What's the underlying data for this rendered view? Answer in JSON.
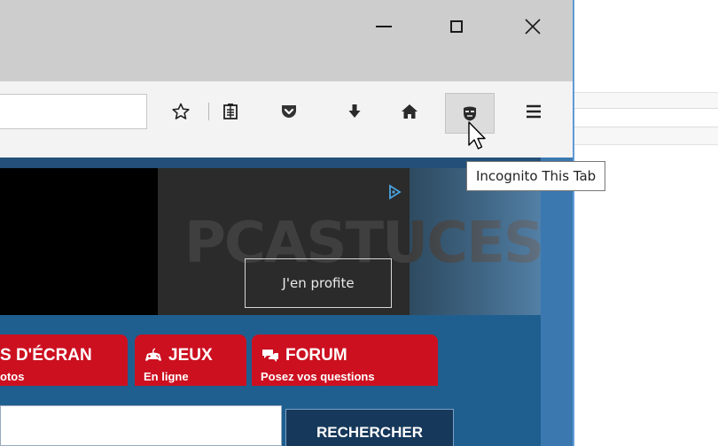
{
  "window_controls": {
    "minimize_label": "Minimize",
    "maximize_label": "Maximize",
    "close_label": "Close"
  },
  "toolbar": {
    "icons": [
      "star-icon",
      "reader-icon",
      "pocket-icon",
      "download-icon",
      "home-icon",
      "incognito-mask-icon",
      "menu-icon"
    ],
    "incognito_active_bg": "#dcdcdc"
  },
  "tooltip": {
    "text": "Incognito This Tab"
  },
  "ad": {
    "logo_text": "PCASTUCES",
    "cta": "J'en profite"
  },
  "site_nav": [
    {
      "title": "S D'ÉCRAN",
      "subtitle": "otos",
      "icon": ""
    },
    {
      "title": "JEUX",
      "subtitle": "En ligne",
      "icon": "gamepad-icon"
    },
    {
      "title": "FORUM",
      "subtitle": "Posez vos questions",
      "icon": "chat-bubble-icon"
    }
  ],
  "search": {
    "button": "RECHERCHER"
  },
  "colors": {
    "accent_red": "#cc1020",
    "page_blue": "#1f5f8f",
    "window_border": "#5e9ad6"
  }
}
